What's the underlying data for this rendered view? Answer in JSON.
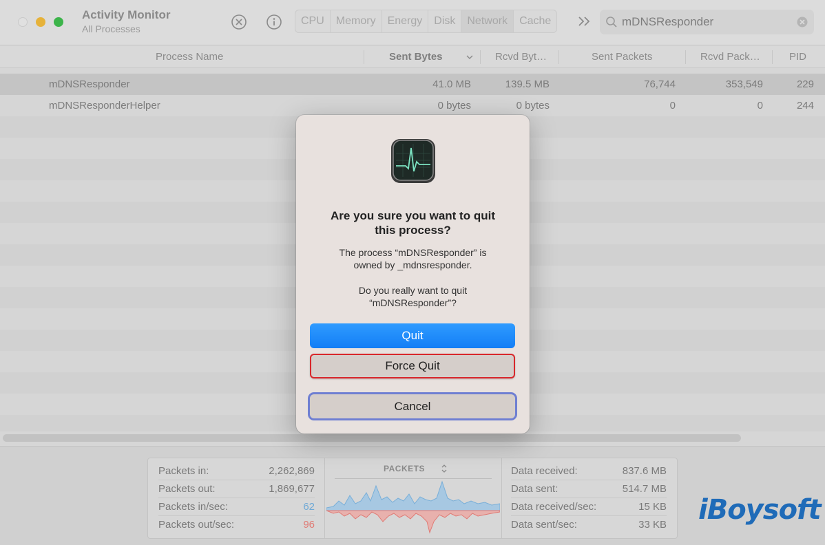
{
  "window": {
    "title": "Activity Monitor",
    "subtitle": "All Processes"
  },
  "toolbar": {
    "tabs": [
      {
        "label": "CPU"
      },
      {
        "label": "Memory"
      },
      {
        "label": "Energy"
      },
      {
        "label": "Disk"
      },
      {
        "label": "Network",
        "active": true
      },
      {
        "label": "Cache"
      }
    ],
    "search": {
      "value": "mDNSResponder"
    }
  },
  "table": {
    "columns": [
      "Process Name",
      "Sent Bytes",
      "Rcvd Byt…",
      "Sent Packets",
      "Rcvd Pack…",
      "PID"
    ],
    "rows": [
      {
        "name": "mDNSResponder",
        "sent_bytes": "41.0 MB",
        "rcvd_bytes": "139.5 MB",
        "sent_packets": "76,744",
        "rcvd_packets": "353,549",
        "pid": "229"
      },
      {
        "name": "mDNSResponderHelper",
        "sent_bytes": "0 bytes",
        "rcvd_bytes": "0 bytes",
        "sent_packets": "0",
        "rcvd_packets": "0",
        "pid": "244"
      }
    ]
  },
  "footer": {
    "left": [
      {
        "label": "Packets in:",
        "value": "2,262,869"
      },
      {
        "label": "Packets out:",
        "value": "1,869,677"
      },
      {
        "label": "Packets in/sec:",
        "value": "62"
      },
      {
        "label": "Packets out/sec:",
        "value": "96"
      }
    ],
    "graph_title": "PACKETS",
    "right": [
      {
        "label": "Data received:",
        "value": "837.6 MB"
      },
      {
        "label": "Data sent:",
        "value": "514.7 MB"
      },
      {
        "label": "Data received/sec:",
        "value": "15 KB"
      },
      {
        "label": "Data sent/sec:",
        "value": "33 KB"
      }
    ]
  },
  "brand": "iBoysoft",
  "dialog": {
    "title_line1": "Are you sure you want to quit",
    "title_line2": "this process?",
    "message_line1": "The process “mDNSResponder” is",
    "message_line2": "owned by _mdnsresponder.",
    "question_line1": "Do you really want to quit",
    "question_line2": "“mDNSResponder”?",
    "quit_label": "Quit",
    "force_quit_label": "Force Quit",
    "cancel_label": "Cancel"
  },
  "colors": {
    "accent_blue": "#137ef6",
    "highlight_red": "#d9272b",
    "focus_ring": "#6f7fd2",
    "packets_in": "#6fa9d6",
    "packets_out": "#e07a74"
  }
}
